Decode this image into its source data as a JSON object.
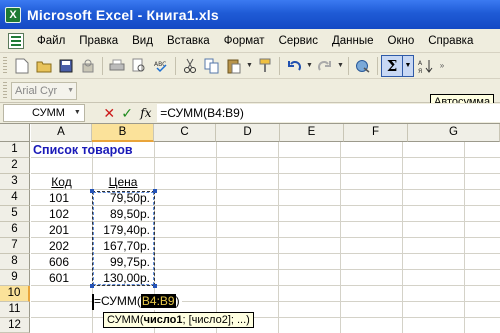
{
  "window": {
    "title": "Microsoft Excel - Книга1.xls",
    "app_icon": "X"
  },
  "menu": [
    {
      "label": "Файл"
    },
    {
      "label": "Правка"
    },
    {
      "label": "Вид"
    },
    {
      "label": "Вставка"
    },
    {
      "label": "Формат"
    },
    {
      "label": "Сервис"
    },
    {
      "label": "Данные"
    },
    {
      "label": "Окно"
    },
    {
      "label": "Справка"
    }
  ],
  "toolbar": {
    "autosum_tooltip": "Автосумма",
    "font_name": "Arial Cyr"
  },
  "formula_bar": {
    "name_box": "СУММ",
    "fx_label": "fx",
    "formula": "=СУММ(B4:B9)"
  },
  "columns": [
    "A",
    "B",
    "C",
    "D",
    "E",
    "F",
    "G"
  ],
  "rows": [
    "1",
    "2",
    "3",
    "4",
    "5",
    "6",
    "7",
    "8",
    "9",
    "10",
    "11",
    "12"
  ],
  "sheet": {
    "title": "Список товаров",
    "header_code": "Код",
    "header_price": "Цена",
    "items": [
      {
        "code": "101",
        "price": "79,50р."
      },
      {
        "code": "102",
        "price": "89,50р."
      },
      {
        "code": "201",
        "price": "179,40р."
      },
      {
        "code": "202",
        "price": "167,70р."
      },
      {
        "code": "606",
        "price": "99,75р."
      },
      {
        "code": "601",
        "price": "130,00р."
      }
    ],
    "editing_prefix": "=СУММ(",
    "editing_ref": "B4:B9",
    "editing_suffix": ")",
    "arg_tip_prefix": "СУММ(",
    "arg_tip_bold": "число1",
    "arg_tip_rest": "; [число2]; ...)"
  },
  "colors": {
    "title_blue": "#1a1ab8",
    "selection": "#fbe29a",
    "xp_title": "#1f5bd6"
  }
}
